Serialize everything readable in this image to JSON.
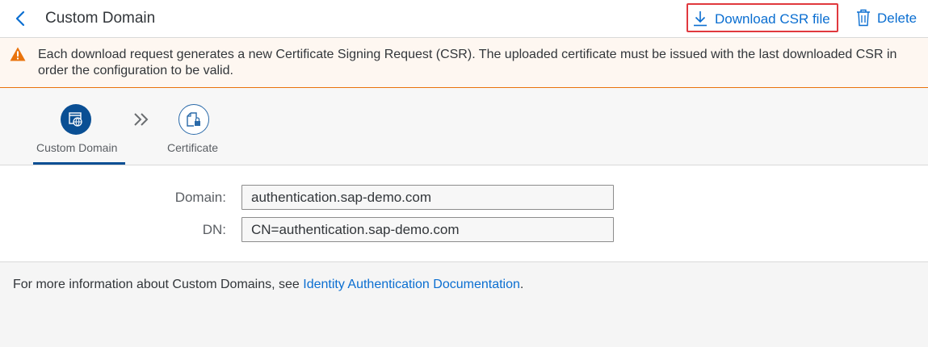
{
  "header": {
    "title": "Custom Domain",
    "back_icon": "chevron-left-icon",
    "download_csr_label": "Download CSR file",
    "download_icon": "download-icon",
    "delete_label": "Delete",
    "delete_icon": "trash-icon"
  },
  "warning": {
    "icon": "warning-icon",
    "text": "Each download request generates a new Certificate Signing Request (CSR). The uploaded certificate must be issued with the last downloaded CSR in order the configuration to be valid."
  },
  "wizard": {
    "steps": [
      {
        "label": "Custom Domain",
        "icon": "domain-icon",
        "active": true
      },
      {
        "label": "Certificate",
        "icon": "certificate-lock-icon",
        "active": false
      }
    ],
    "separator_icon": "double-chevron-right-icon"
  },
  "form": {
    "domain_label": "Domain:",
    "domain_value": "authentication.sap-demo.com",
    "dn_label": "DN:",
    "dn_value": "CN=authentication.sap-demo.com"
  },
  "info": {
    "prefix": "For more information about Custom Domains, see ",
    "link": "Identity Authentication Documentation",
    "suffix": "."
  },
  "colors": {
    "accent": "#0a6ed1",
    "active_step": "#0a4f94",
    "warning": "#e9730c",
    "highlight_border": "#e0393e"
  }
}
